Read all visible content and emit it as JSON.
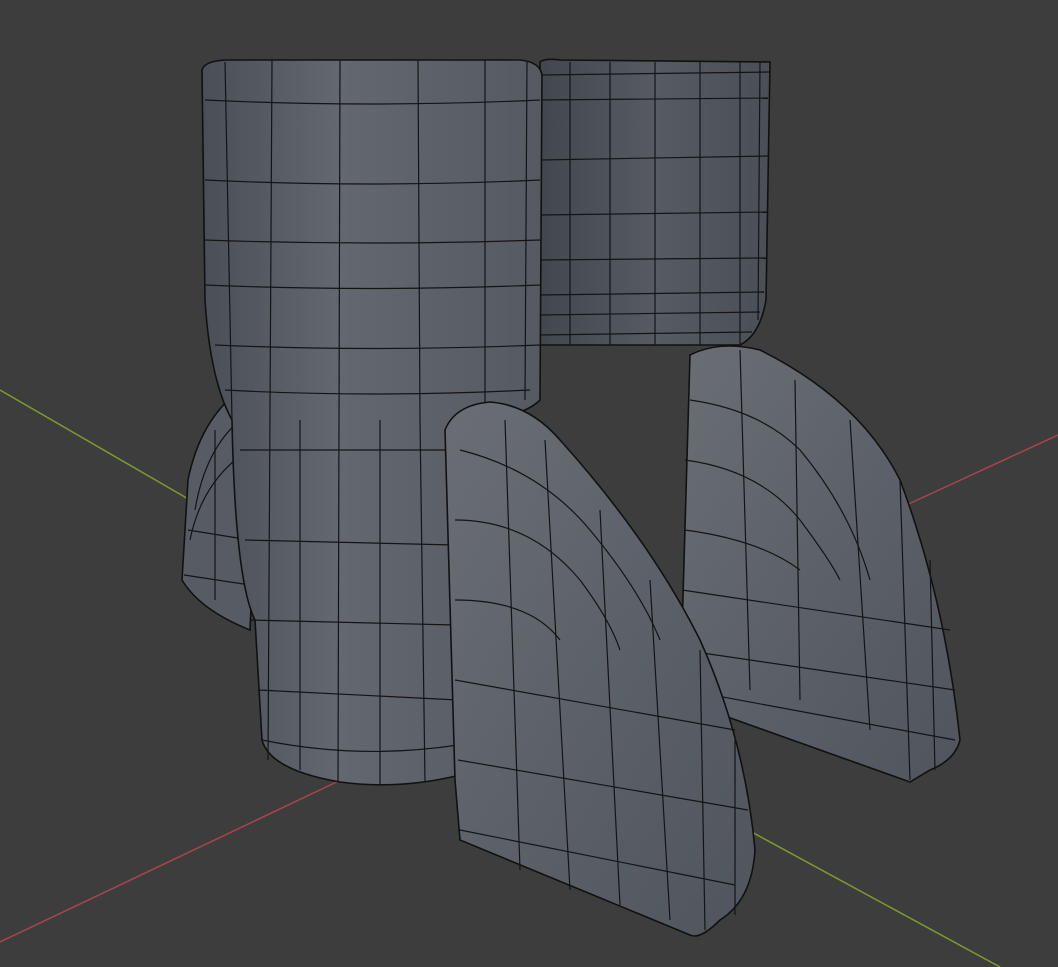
{
  "viewport": {
    "mode": "3d-viewport",
    "colors": {
      "background": "#3d3d3d",
      "x_axis": "#a8454f",
      "y_axis": "#7d9a2e",
      "mesh": "#5b6169",
      "mesh_light": "#6e737a",
      "mesh_dark": "#454a52",
      "wire": "#141414"
    }
  }
}
